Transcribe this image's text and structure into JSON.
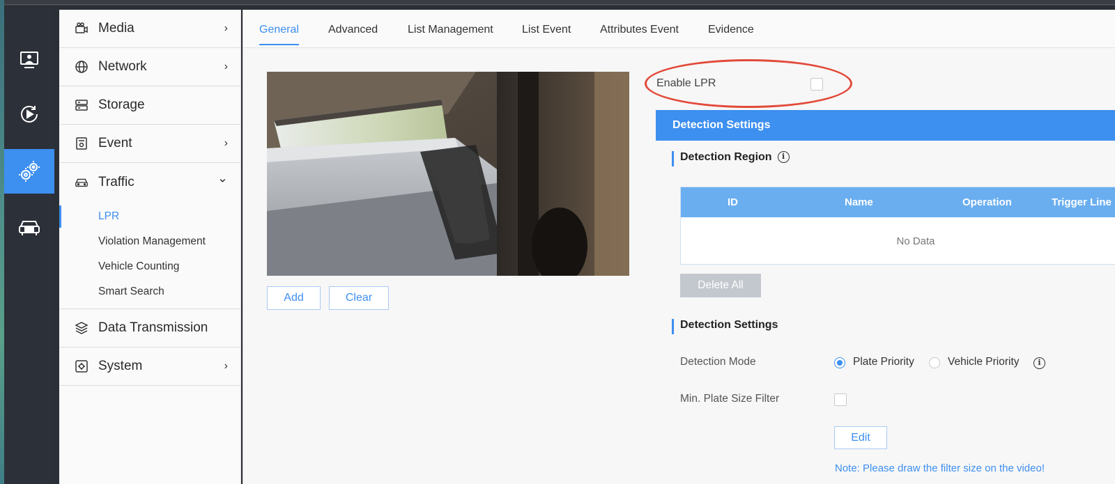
{
  "sidebar": {
    "items": [
      {
        "label": "Media",
        "icon": "camera-icon"
      },
      {
        "label": "Network",
        "icon": "globe-icon"
      },
      {
        "label": "Storage",
        "icon": "storage-icon"
      },
      {
        "label": "Event",
        "icon": "event-icon"
      },
      {
        "label": "Traffic",
        "icon": "car-icon"
      },
      {
        "label": "Data Transmission",
        "icon": "layers-icon"
      },
      {
        "label": "System",
        "icon": "system-icon"
      }
    ],
    "traffic_sub": [
      "LPR",
      "Violation Management",
      "Vehicle Counting",
      "Smart Search"
    ],
    "chevron_right": "›",
    "chevron_down": "⌄"
  },
  "tabs": [
    "General",
    "Advanced",
    "List Management",
    "List Event",
    "Attributes Event",
    "Evidence"
  ],
  "video": {
    "add_label": "Add",
    "clear_label": "Clear"
  },
  "lpr": {
    "enable_label": "Enable LPR",
    "detection_settings_header": "Detection Settings",
    "detection_region_heading": "Detection Region",
    "table_headers": [
      "ID",
      "Name",
      "Operation",
      "Trigger Line"
    ],
    "no_data": "No Data",
    "delete_all": "Delete All",
    "detection_settings_heading": "Detection Settings",
    "detection_mode_label": "Detection Mode",
    "mode_options": [
      "Plate Priority",
      "Vehicle Priority"
    ],
    "min_plate_label": "Min. Plate Size Filter",
    "edit_label": "Edit",
    "note": "Note: Please draw the filter size on the video!",
    "info_glyph": "i"
  },
  "colors": {
    "accent": "#3d8ff0",
    "highlight": "#e24a3a",
    "rail": "#2c3038"
  }
}
